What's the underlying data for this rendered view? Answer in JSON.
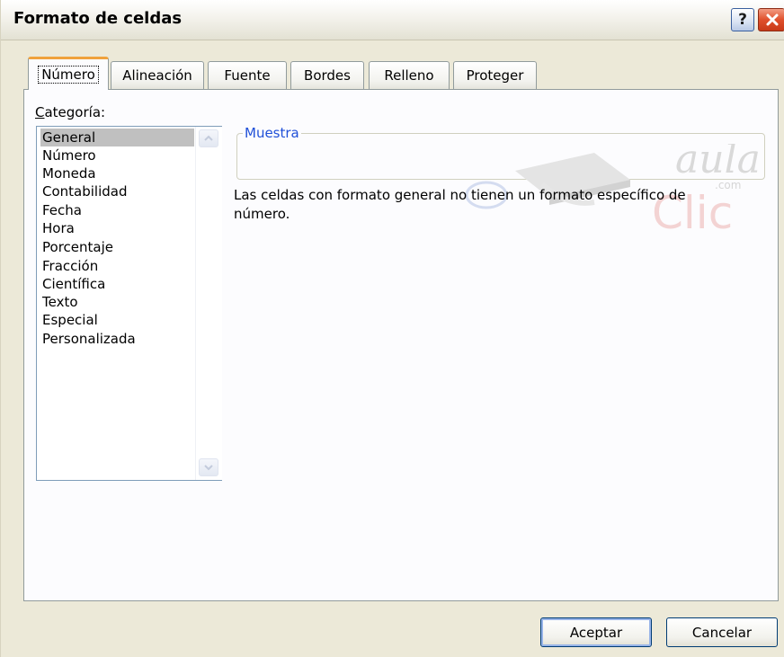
{
  "window": {
    "title": "Formato de celdas",
    "help_glyph": "?",
    "help_icon": "question-icon",
    "close_icon": "close-icon"
  },
  "tabs": [
    {
      "label": "Número",
      "active": true
    },
    {
      "label": "Alineación",
      "active": false
    },
    {
      "label": "Fuente",
      "active": false
    },
    {
      "label": "Bordes",
      "active": false
    },
    {
      "label": "Relleno",
      "active": false
    },
    {
      "label": "Proteger",
      "active": false
    }
  ],
  "category": {
    "label_first": "C",
    "label_rest": "ategoría:",
    "selected": "General",
    "items": [
      "General",
      "Número",
      "Moneda",
      "Contabilidad",
      "Fecha",
      "Hora",
      "Porcentaje",
      "Fracción",
      "Científica",
      "Texto",
      "Especial",
      "Personalizada"
    ],
    "scroll_up_icon": "chevron-up-icon",
    "scroll_down_icon": "chevron-down-icon"
  },
  "sample": {
    "legend": "Muestra",
    "value": ""
  },
  "description": "Las celdas con formato general no tienen un formato específico de número.",
  "watermark": {
    "brand_top": "aula",
    "brand_domain": ".com",
    "brand_bottom": "Clic"
  },
  "buttons": {
    "ok": "Aceptar",
    "cancel": "Cancelar"
  },
  "colors": {
    "accent_tab": "#f0a23c",
    "legend_blue": "#2050d8",
    "close_red": "#e0502c",
    "selection_gray": "#c0c0c0"
  }
}
